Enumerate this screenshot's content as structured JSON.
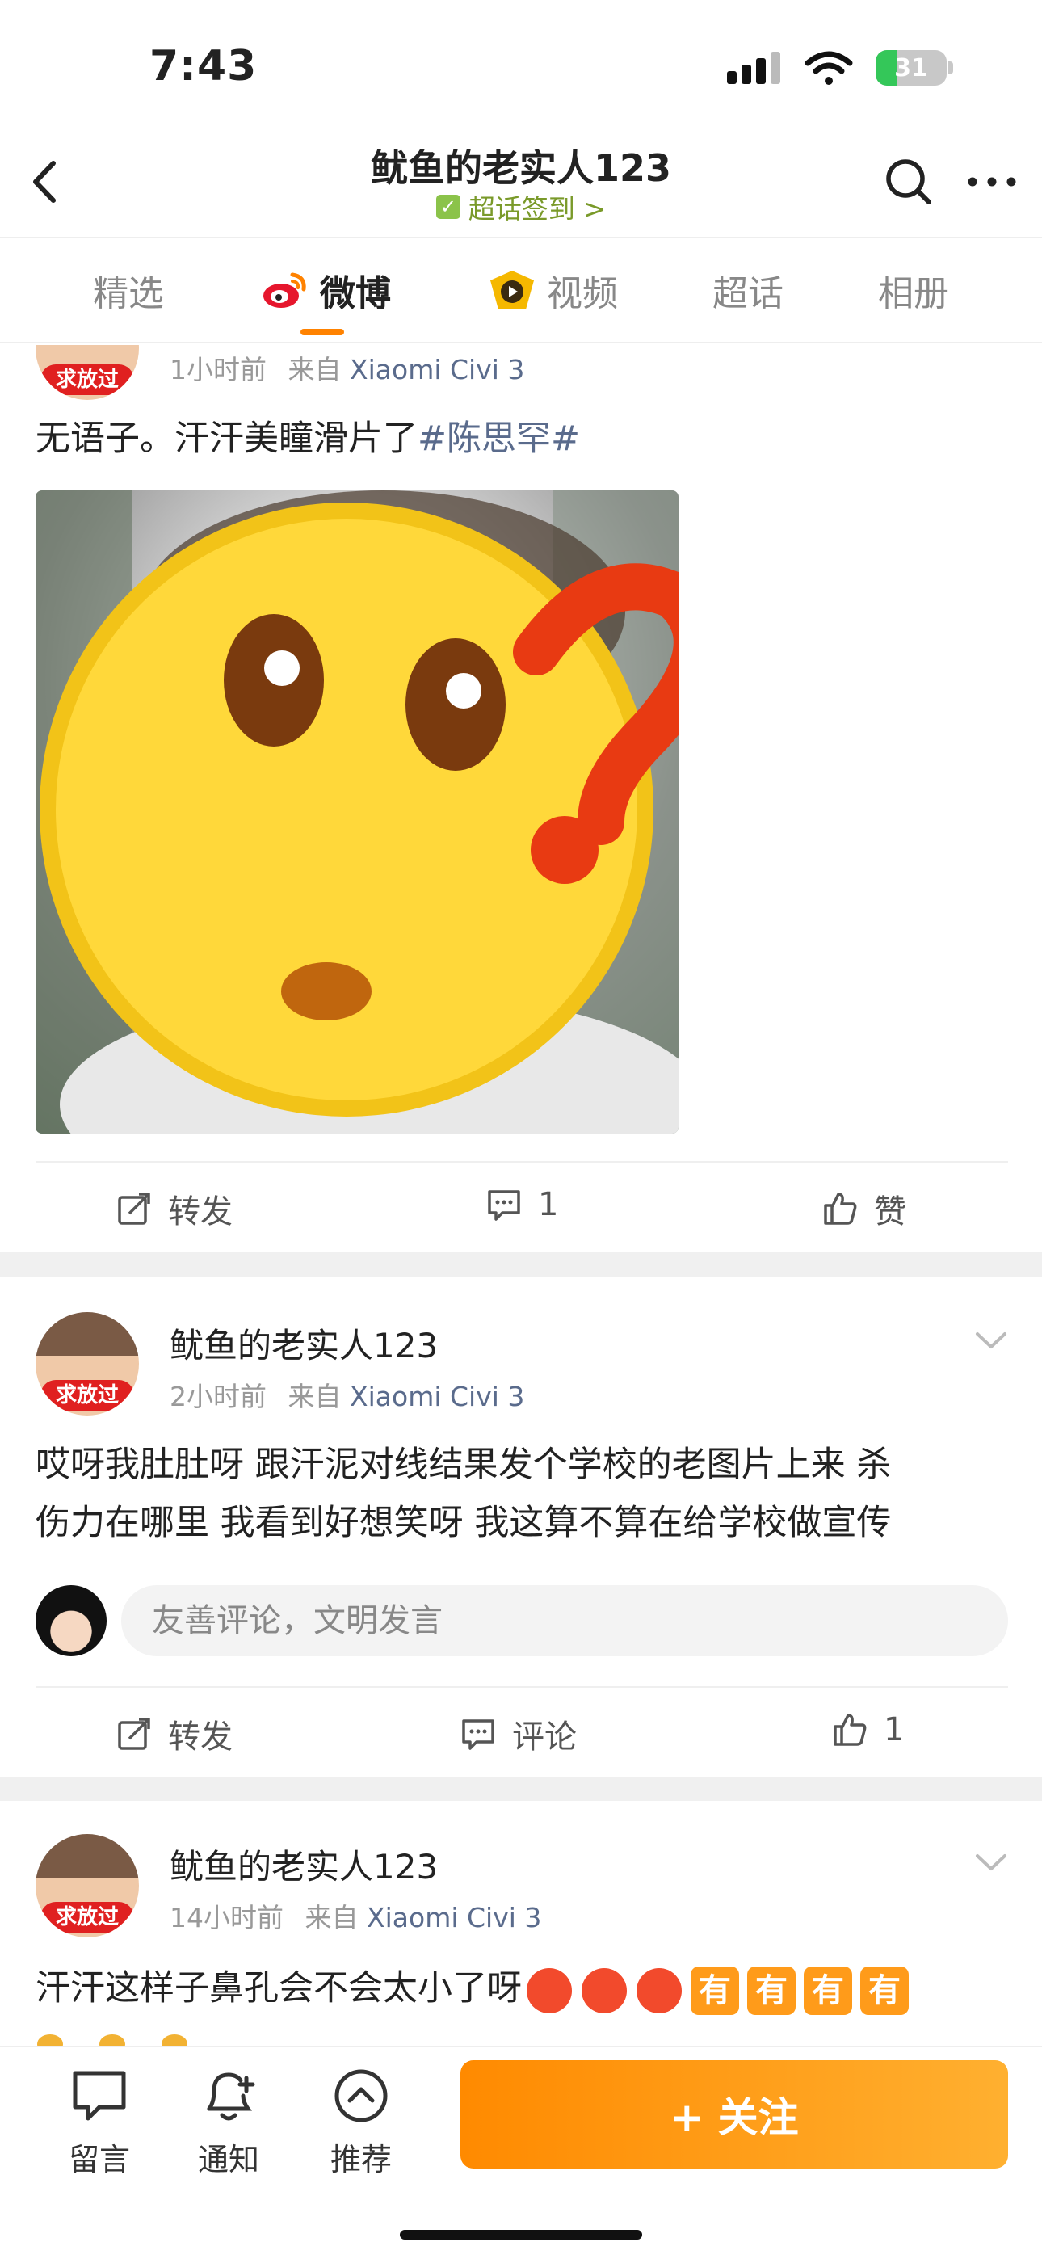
{
  "status_bar": {
    "time": "7:43",
    "battery": "31",
    "battery_level": 0.31
  },
  "header": {
    "title": "鱿鱼的老实人123",
    "subtitle": "超话签到 >"
  },
  "tabs": [
    {
      "label": "精选",
      "active": false
    },
    {
      "label": "微博",
      "active": true
    },
    {
      "label": "视频",
      "active": false
    },
    {
      "label": "超话",
      "active": false
    },
    {
      "label": "相册",
      "active": false
    }
  ],
  "posts": [
    {
      "avatar_badge": "求放过",
      "time": "1小时前",
      "from_label": "来自",
      "source": "Xiaomi Civi 3",
      "text": "无语子。汗汗美瞳滑片了",
      "topic": "#陈思罕#",
      "actions": {
        "repost": "转发",
        "comment_count": "1",
        "like": "赞"
      }
    },
    {
      "name": "鱿鱼的老实人123",
      "avatar_badge": "求放过",
      "time": "2小时前",
      "from_label": "来自",
      "source": "Xiaomi Civi 3",
      "text_line1": "哎呀我肚肚呀 跟汗泥对线结果发个学校的老图片上来 杀",
      "text_line2": "伤力在哪里 我看到好想笑呀 我这算不算在给学校做宣传",
      "comment_placeholder": "友善评论，文明发言",
      "actions": {
        "repost": "转发",
        "comment": "评论",
        "like_count": "1"
      }
    },
    {
      "name": "鱿鱼的老实人123",
      "avatar_badge": "求放过",
      "time": "14小时前",
      "from_label": "来自",
      "source": "Xiaomi Civi 3",
      "text": "汗汗这样子鼻孔会不会太小了呀",
      "emoji_text": "有"
    }
  ],
  "bottom_bar": {
    "message": "留言",
    "notify": "通知",
    "recommend": "推荐",
    "follow": "+ 关注"
  },
  "colors": {
    "accent": "#ff8200",
    "link": "#5a6b8c",
    "badge": "#e02020"
  }
}
